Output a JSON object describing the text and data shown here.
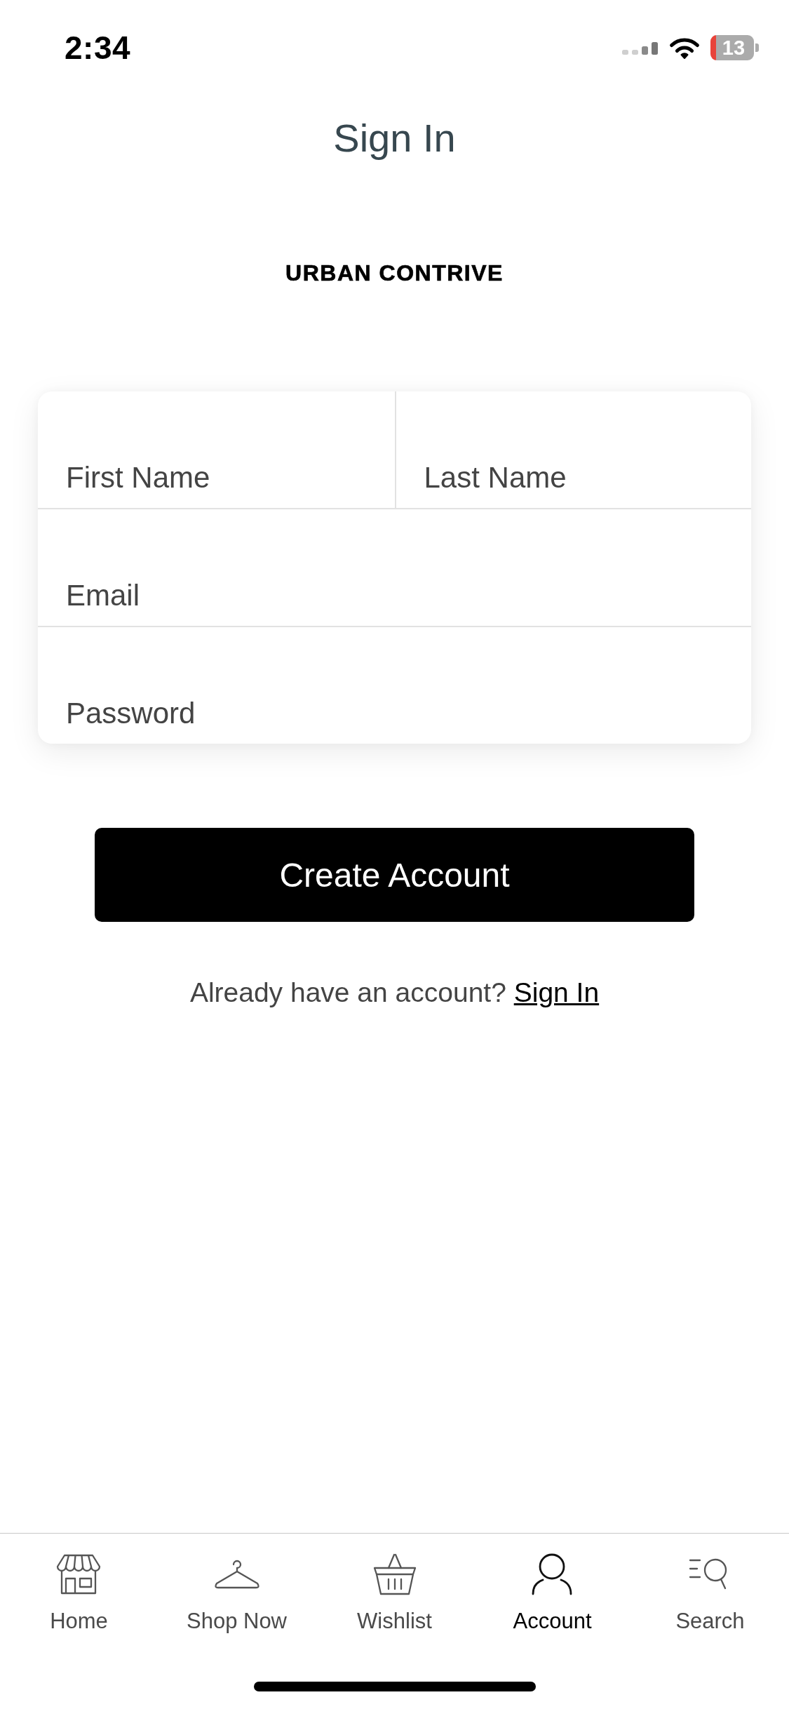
{
  "status_bar": {
    "time": "2:34",
    "battery": "13"
  },
  "header": {
    "title": "Sign In"
  },
  "logo": {
    "text": "URBAN CONTRIVE"
  },
  "form": {
    "rows": [
      {
        "fields": [
          {
            "placeholder": "First Name"
          },
          {
            "placeholder": "Last Name"
          }
        ]
      },
      {
        "fields": [
          {
            "placeholder": "Email"
          }
        ]
      },
      {
        "fields": [
          {
            "placeholder": "Password"
          }
        ]
      }
    ]
  },
  "create_button": {
    "label": "Create Account"
  },
  "signin_prompt": {
    "text": "Already have an account?",
    "link": "Sign In"
  },
  "tab_bar": {
    "tabs": [
      {
        "kind": "home",
        "label": "Home",
        "selected": false
      },
      {
        "kind": "shop",
        "label": "Shop Now",
        "selected": false
      },
      {
        "kind": "wishlist",
        "label": "Wishlist",
        "selected": false
      },
      {
        "kind": "account",
        "label": "Account",
        "selected": true
      },
      {
        "kind": "search",
        "label": "Search",
        "selected": false
      }
    ]
  }
}
